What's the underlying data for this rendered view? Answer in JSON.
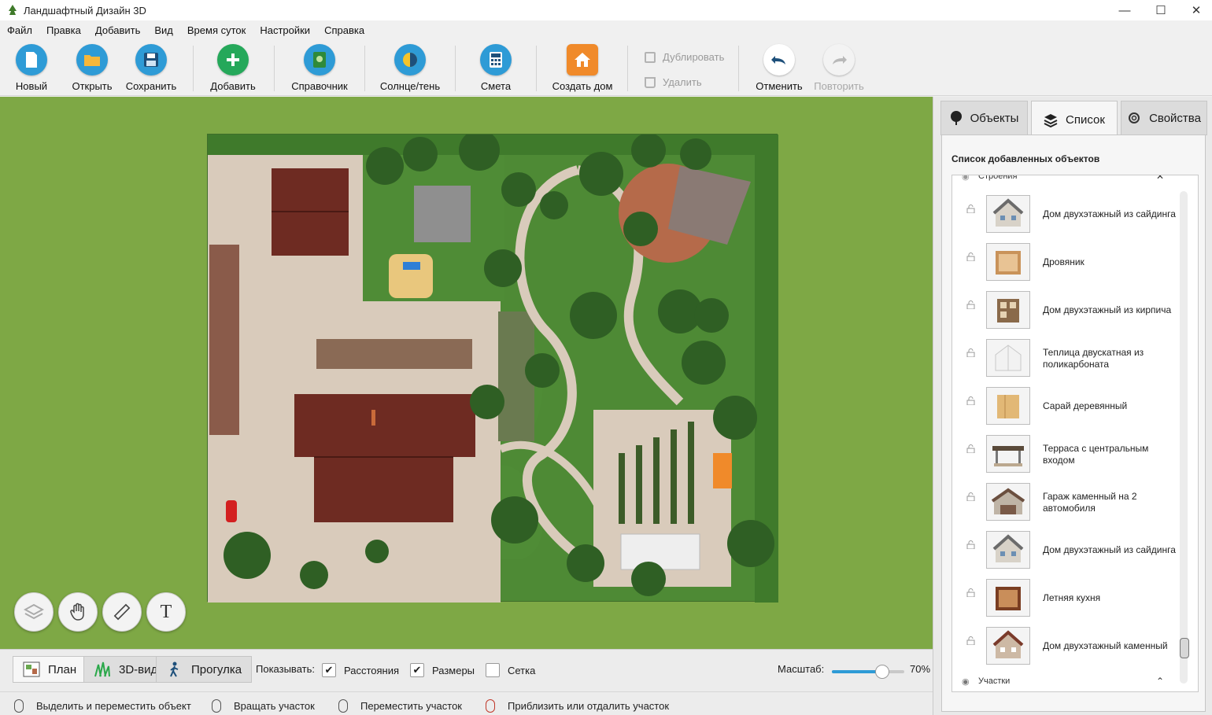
{
  "window": {
    "title": "Ландшафтный Дизайн 3D"
  },
  "menu": [
    "Файл",
    "Правка",
    "Добавить",
    "Вид",
    "Время суток",
    "Настройки",
    "Справка"
  ],
  "toolbar": {
    "new": "Новый",
    "open": "Открыть",
    "save": "Сохранить",
    "add": "Добавить",
    "reference": "Справочник",
    "sun_shade": "Солнце/тень",
    "estimate": "Смета",
    "create_house": "Создать дом",
    "duplicate": "Дублировать",
    "delete": "Удалить",
    "undo": "Отменить",
    "redo": "Повторить"
  },
  "view_tabs": [
    "План",
    "3D-вид",
    "Прогулка"
  ],
  "show": {
    "label": "Показывать:",
    "options": [
      {
        "label": "Расстояния",
        "checked": true
      },
      {
        "label": "Размеры",
        "checked": true
      },
      {
        "label": "Сетка",
        "checked": false
      }
    ]
  },
  "zoom": {
    "label": "Масштаб:",
    "value_text": "70%",
    "value": 70
  },
  "status_hints": [
    "Выделить и переместить объект",
    "Вращать участок",
    "Переместить участок",
    "Приблизить или отдалить участок"
  ],
  "panel": {
    "tabs": [
      "Объекты",
      "Список",
      "Свойства"
    ],
    "active_tab": "Список",
    "heading": "Список добавленных объектов",
    "group_top": "Строения",
    "group_bottom": "Участки",
    "items": [
      "Дом двухэтажный из сайдинга",
      "Дровяник",
      "Дом двухэтажный из кирпича",
      "Теплица двускатная из поликарбоната",
      "Сарай деревянный",
      "Терраса с центральным входом",
      "Гараж каменный на 2 автомобиля",
      "Дом двухэтажный из сайдинга",
      "Летняя кухня",
      "Дом двухэтажный каменный"
    ]
  },
  "colors": {
    "grass": "#7ea845",
    "lot": "#4e8a35",
    "paving": "#d9cbbb",
    "roof": "#6e2b22",
    "accent_orange": "#f08a2a",
    "accent_blue": "#2e9bd6",
    "accent_green": "#2aa84a"
  }
}
